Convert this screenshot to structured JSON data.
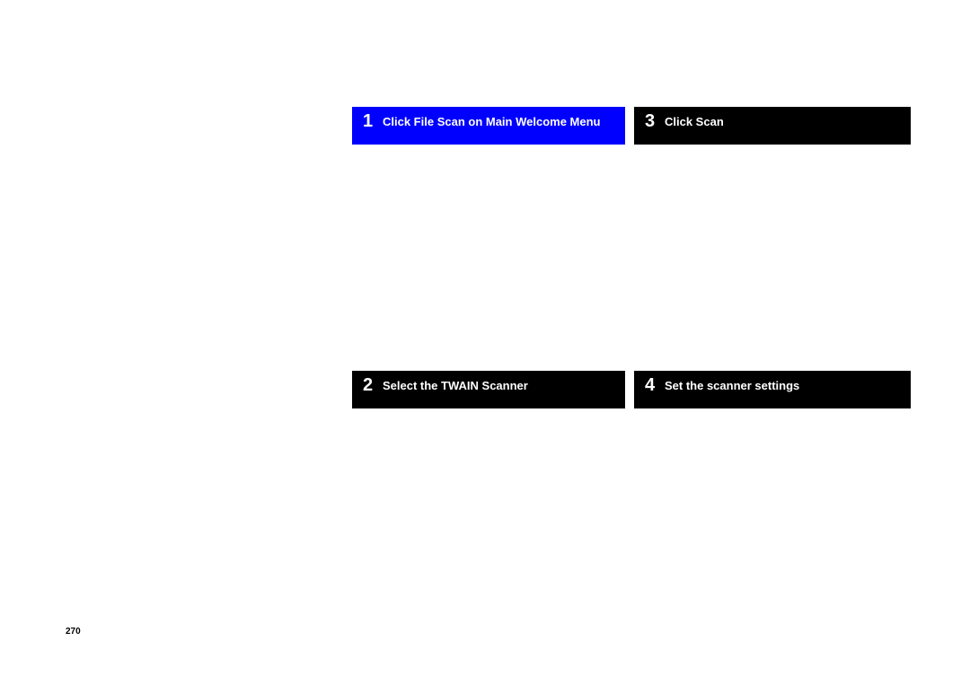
{
  "steps": {
    "s1": {
      "number": "1",
      "title": "Click File Scan on Main Welcome Menu"
    },
    "s2": {
      "number": "2",
      "title": "Select the TWAIN Scanner"
    },
    "s3": {
      "number": "3",
      "title": "Click Scan"
    },
    "s4": {
      "number": "4",
      "title": "Set the scanner settings"
    }
  },
  "pageNumber": "270"
}
